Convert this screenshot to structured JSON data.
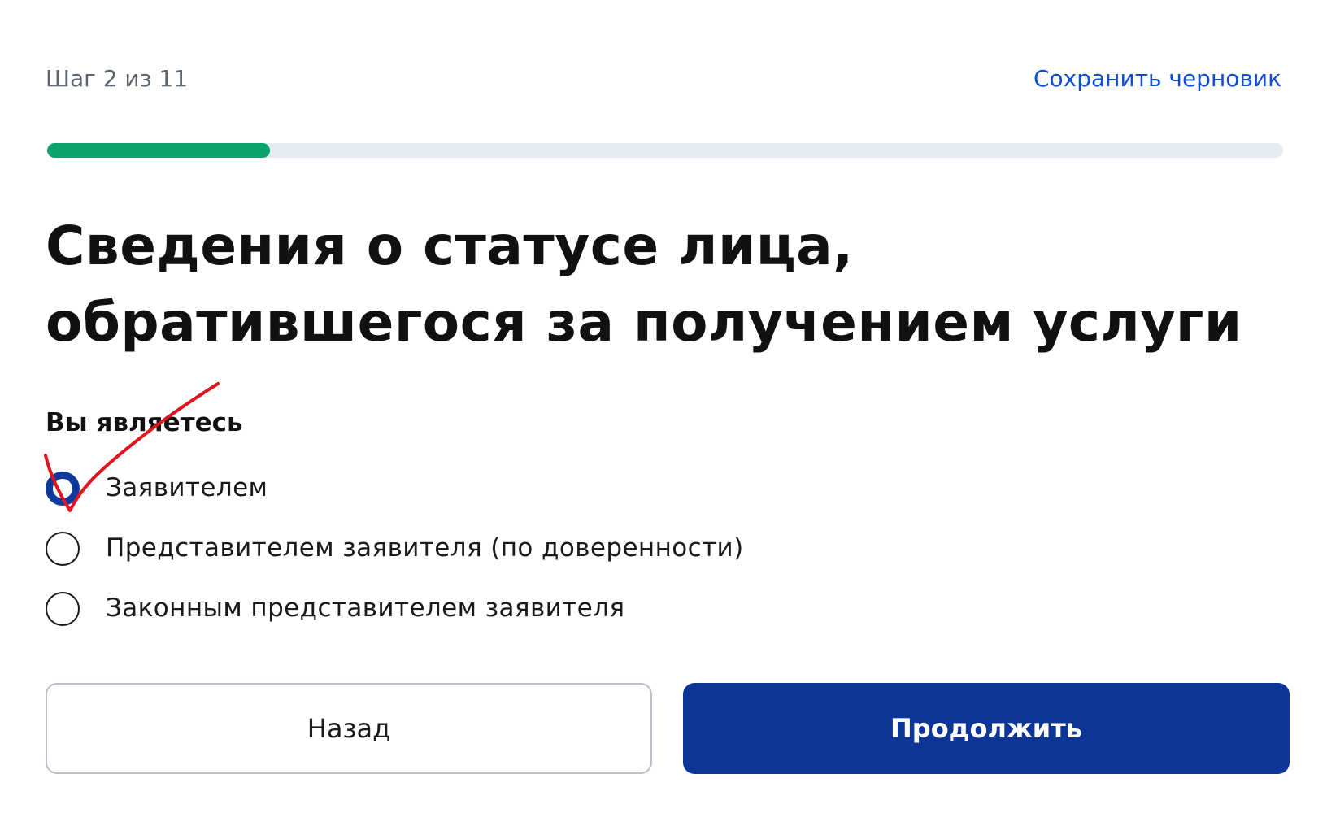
{
  "header": {
    "step_label": "Шаг 2 из 11",
    "save_draft_label": "Сохранить черновик"
  },
  "progress": {
    "fraction": 0.18,
    "color": "#0aa36b",
    "track_color": "#e4ebf2"
  },
  "page": {
    "title_line1": "Сведения о статусе лица,",
    "title_line2": "обратившегося за получением услуги"
  },
  "form": {
    "question": "Вы являетесь",
    "options": [
      {
        "label": "Заявителем",
        "selected": true
      },
      {
        "label": "Представителем заявителя (по доверенности)",
        "selected": false
      },
      {
        "label": "Законным представителем заявителя",
        "selected": false
      }
    ]
  },
  "buttons": {
    "back_label": "Назад",
    "continue_label": "Продолжить",
    "primary_color": "#0d3598"
  },
  "annotation": {
    "icon": "hand-drawn-checkmark",
    "color": "#e0141e"
  }
}
